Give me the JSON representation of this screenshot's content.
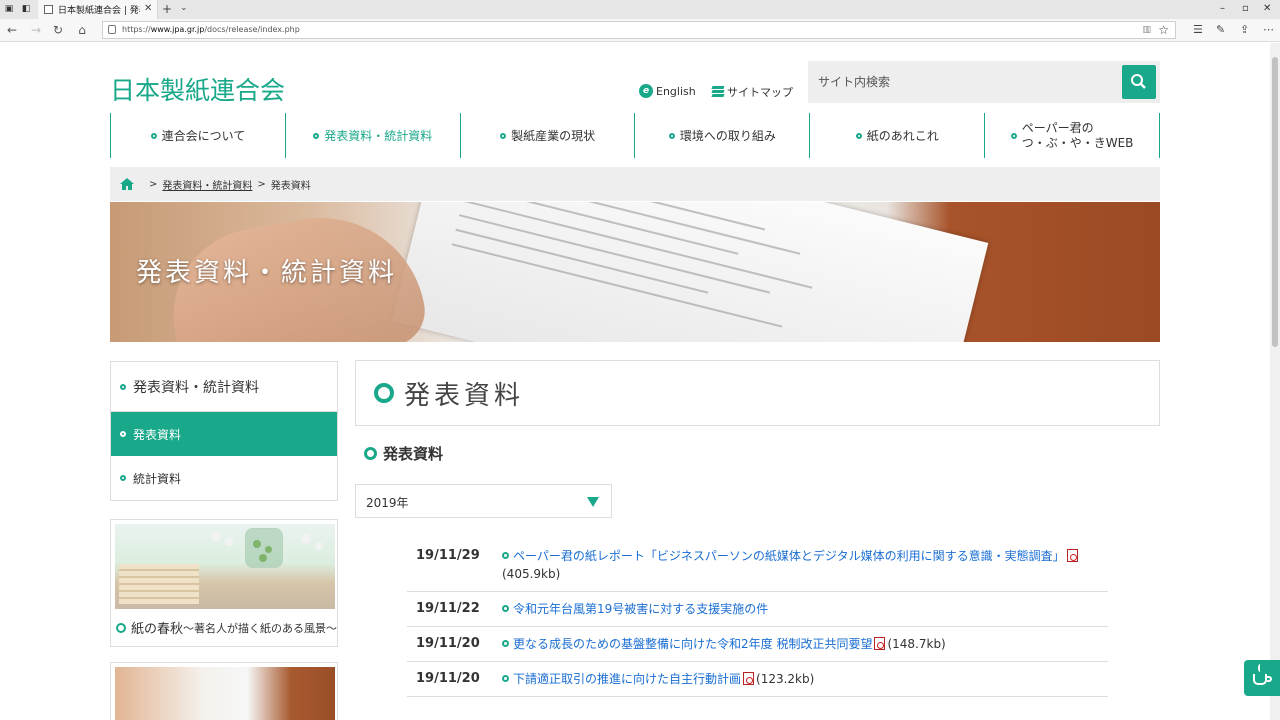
{
  "browser": {
    "tab_title": "日本製紙連合会 | 発表資",
    "url_prefix": "https://",
    "url_host": "www.jpa.gr.jp",
    "url_path": "/docs/release/index.php"
  },
  "header": {
    "logo": "日本製紙連合会",
    "english_link": "English",
    "sitemap_link": "サイトマップ",
    "search_placeholder": "サイト内検索"
  },
  "gnav": [
    {
      "label": "連合会について"
    },
    {
      "label": "発表資料・統計資料"
    },
    {
      "label": "製紙産業の現状"
    },
    {
      "label": "環境への取り組み"
    },
    {
      "label": "紙のあれこれ"
    },
    {
      "label_line1": "ペーパー君の",
      "label_line2": "つ・ぶ・や・きWEB"
    }
  ],
  "breadcrumb": {
    "separator": ">",
    "parent": "発表資料・統計資料",
    "current": "発表資料"
  },
  "hero": {
    "title": "発表資料・統計資料"
  },
  "sidebar": {
    "heading": "発表資料・統計資料",
    "items": [
      {
        "label": "発表資料"
      },
      {
        "label": "統計資料"
      }
    ],
    "banner_title": "紙の春秋",
    "banner_subtitle": "〜著名人が描く紙のある風景〜"
  },
  "main": {
    "title": "発表資料",
    "section_title": "発表資料",
    "year_value": "2019年",
    "news": [
      {
        "date": "19/11/29",
        "title": "ペーパー君の紙レポート「ビジネスパーソンの紙媒体とデジタル媒体の利用に関する意識・実態調査」",
        "size": "(405.9kb)"
      },
      {
        "date": "19/11/22",
        "title": "令和元年台風第19号被害に対する支援実施の件",
        "size": ""
      },
      {
        "date": "19/11/20",
        "title": "更なる成長のための基盤整備に向けた令和2年度 税制改正共同要望",
        "size": "(148.7kb)"
      },
      {
        "date": "19/11/20",
        "title": "下請適正取引の推進に向けた自主行動計画",
        "size": "(123.2kb)"
      }
    ]
  },
  "colors": {
    "brand": "#1aa88a",
    "link": "#1a6ed3"
  }
}
